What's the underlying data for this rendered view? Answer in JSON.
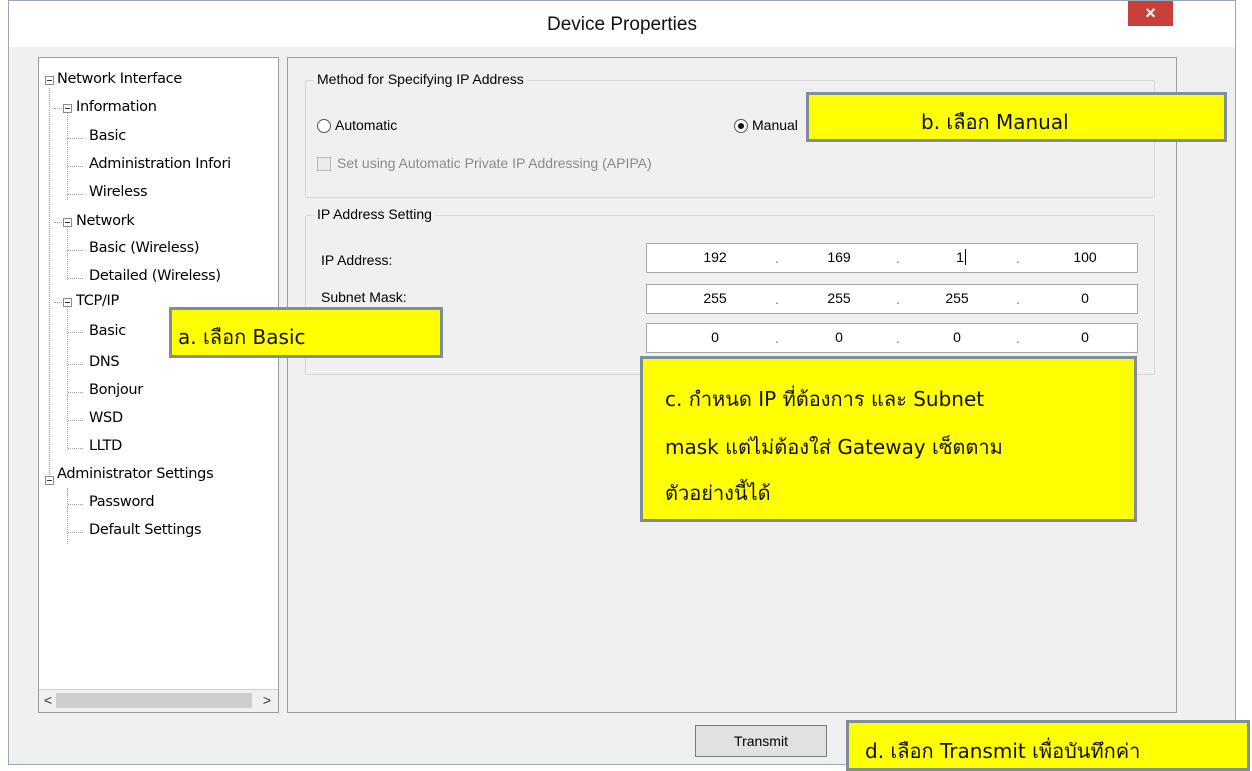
{
  "window": {
    "title": "Device Properties",
    "close": "×"
  },
  "tree": {
    "items": [
      "Network Interface",
      "Information",
      "Basic",
      "Administration Infori",
      "Wireless",
      "Network",
      "Basic (Wireless)",
      "Detailed (Wireless)",
      "TCP/IP",
      "Basic",
      "DNS",
      "Bonjour",
      "WSD",
      "LLTD",
      "Administrator Settings",
      "Password",
      "Default Settings"
    ],
    "scroll_left": "<",
    "scroll_right": ">"
  },
  "method": {
    "group_title": "Method for Specifying IP Address",
    "automatic": "Automatic",
    "manual": "Manual",
    "selected": "Manual",
    "apipa": "Set using Automatic Private IP Addressing (APIPA)"
  },
  "ip_setting": {
    "group_title": "IP Address Setting",
    "ip_label": "IP Address:",
    "subnet_label": "Subnet Mask:",
    "ip": [
      "192",
      "169",
      "1",
      "100"
    ],
    "subnet": [
      "255",
      "255",
      "255",
      "0"
    ],
    "gateway": [
      "0",
      "0",
      "0",
      "0"
    ],
    "dot": "."
  },
  "buttons": {
    "transmit": "Transmit"
  },
  "callouts": {
    "a": "a. เลือก Basic",
    "b": "b. เลือก Manual",
    "c_line1": "c. กำหนด IP ที่ต้องการ และ Subnet",
    "c_line2": "mask  แต่ไม่ต้องใส่ Gateway  เซ็ตตาม",
    "c_line3": "ตัวอย่างนี้ได้",
    "d": "d. เลือก Transmit เพื่อบันทึกค่า"
  },
  "colors": {
    "callout_bg": "#ffff00",
    "callout_border": "#7f8f99",
    "close_bg": "#c7413a"
  }
}
